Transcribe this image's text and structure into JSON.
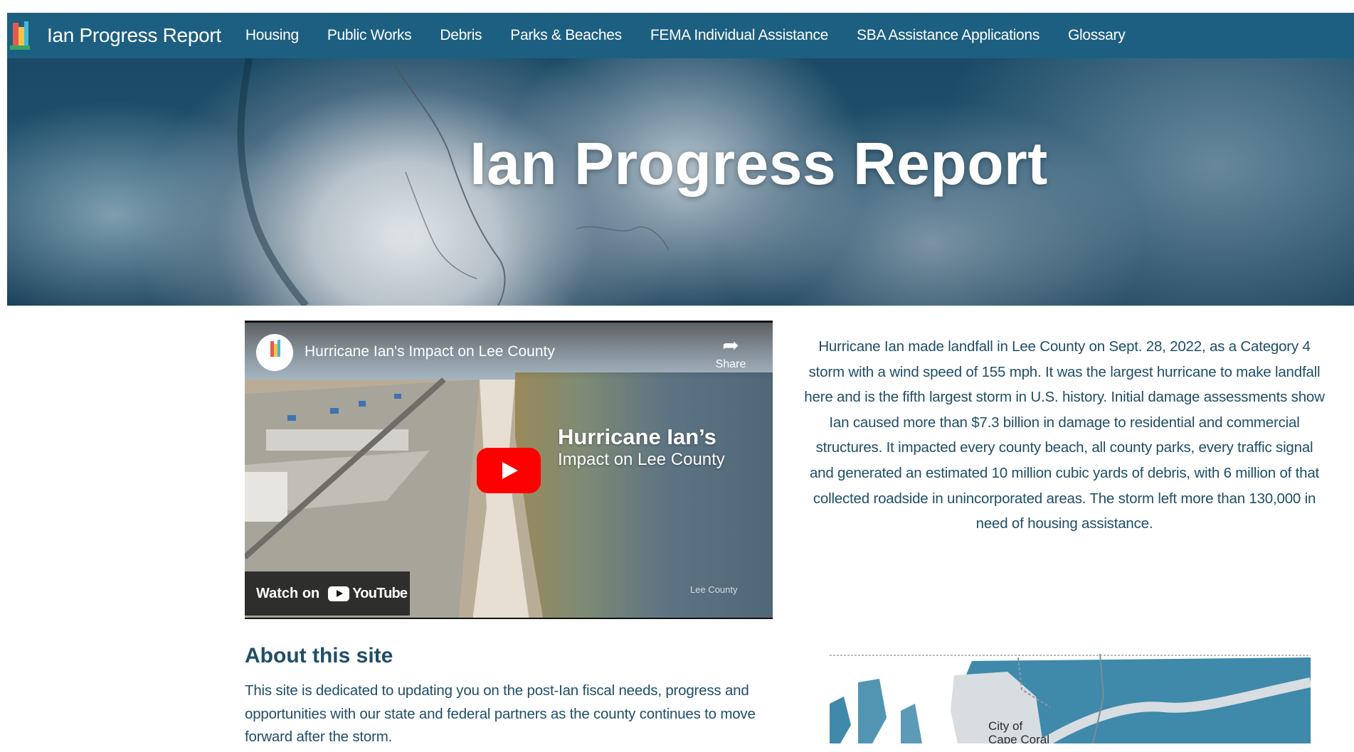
{
  "nav": {
    "title": "Ian Progress Report",
    "items": [
      "Housing",
      "Public Works",
      "Debris",
      "Parks & Beaches",
      "FEMA Individual Assistance",
      "SBA Assistance Applications",
      "Glossary"
    ]
  },
  "hero": {
    "title": "Ian Progress Report"
  },
  "video": {
    "title": "Hurricane Ian's Impact on Lee County",
    "share_label": "Share",
    "overlay_title": "Hurricane Ian’s",
    "overlay_subtitle": "Impact on Lee County",
    "watch_on_label": "Watch on",
    "youtube_word": "YouTube",
    "watermark": "Lee County"
  },
  "description": "Hurricane Ian made landfall in Lee County on Sept. 28, 2022, as a Category 4 storm with a wind speed of 155 mph. It was the largest hurricane to make landfall here and is the fifth largest storm in U.S. history. Initial damage assessments show Ian caused more than $7.3 billion in damage to residential and commercial structures. It impacted every county beach, all county parks, every traffic signal and generated an estimated 10 million cubic yards of debris, with 6 million of that collected roadside in unincorporated areas. The storm left more than 130,000 in need of housing assistance.",
  "about": {
    "heading": "About this site",
    "text": "This site is dedicated to updating you on the post-Ian fiscal needs, progress and opportunities with our state and federal partners as the county continues to move forward after the storm."
  },
  "map": {
    "label_line1": "City of",
    "label_line2": "Cape Coral"
  },
  "colors": {
    "nav_bg": "#1d5f80",
    "text": "#1f4e66",
    "youtube_red": "#ff0000",
    "map_fill": "#3f89aa"
  }
}
